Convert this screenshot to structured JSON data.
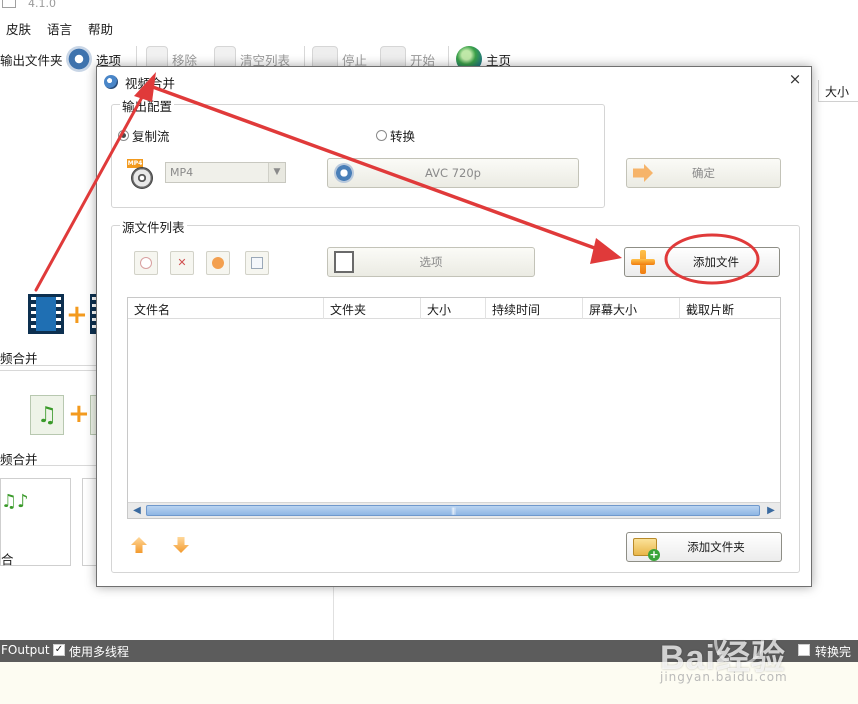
{
  "app": {
    "version": "4.1.0",
    "menu": [
      "皮肤",
      "语言",
      "帮助"
    ],
    "toolbar": {
      "output_folder": "输出文件夹",
      "options": "选项",
      "remove": "移除",
      "clear_list": "清空列表",
      "stop": "停止",
      "start": "开始",
      "home": "主页"
    },
    "list_header_size": "大小",
    "left_panel": {
      "video_join": "频合并",
      "audio_join": "频合并",
      "third": "合"
    },
    "statusbar": {
      "output": "FOutput",
      "multithread": "使用多线程",
      "after_convert": "转换完成"
    },
    "watermark": {
      "main": "Bai经验",
      "sub": "jingyan.baidu.com"
    }
  },
  "dialog": {
    "title": "视频合并",
    "close": "×",
    "output_group": {
      "title": "输出配置",
      "radio_copy_stream": "复制流",
      "radio_convert": "转换",
      "selected": "复制流",
      "format_value": "MP4",
      "profile_button": "AVC 720p",
      "ok_button": "确定"
    },
    "source_group": {
      "title": "源文件列表",
      "options_button": "选项",
      "add_file_button": "添加文件",
      "add_folder_button": "添加文件夹",
      "columns": [
        "文件名",
        "文件夹",
        "大小",
        "持续时间",
        "屏幕大小",
        "截取片断"
      ],
      "scroll_grip": "|||"
    }
  },
  "annotation": {
    "color": "#e03a3a"
  }
}
